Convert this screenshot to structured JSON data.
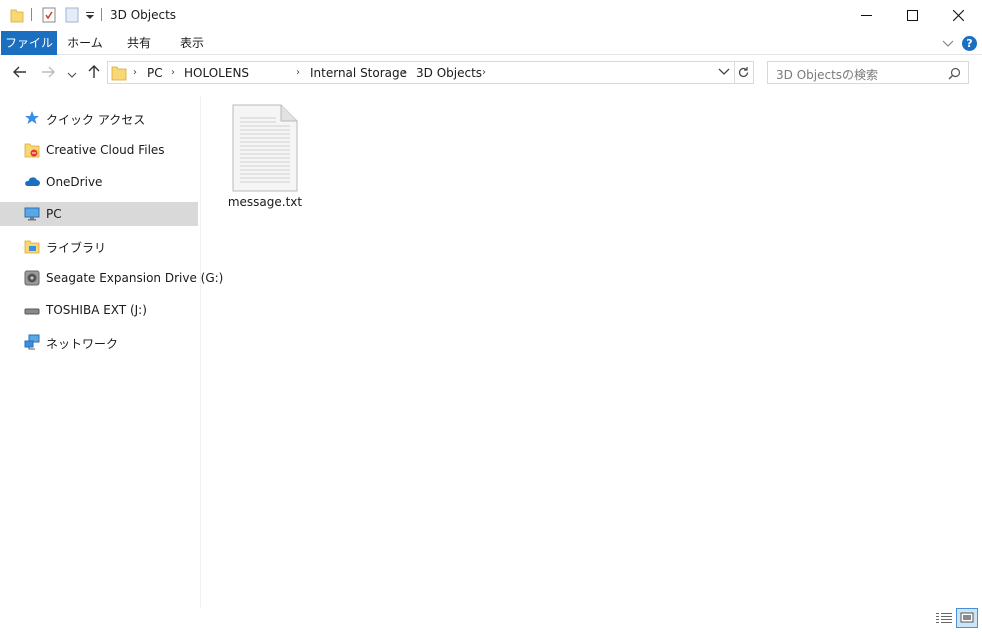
{
  "window": {
    "title": "3D Objects"
  },
  "ribbon": {
    "tabs": [
      "ファイル",
      "ホーム",
      "共有",
      "表示"
    ],
    "help_label": "?"
  },
  "address": {
    "crumbs": [
      "PC",
      "HOLOLENS",
      "Internal Storage",
      "3D Objects"
    ]
  },
  "search": {
    "placeholder": "3D Objectsの検索"
  },
  "sidebar": {
    "items": [
      {
        "label": "クイック アクセス",
        "icon": "star-icon"
      },
      {
        "label": "Creative Cloud Files",
        "icon": "creative-cloud-folder-icon"
      },
      {
        "label": "OneDrive",
        "icon": "cloud-icon"
      },
      {
        "label": "PC",
        "icon": "computer-icon",
        "selected": true
      },
      {
        "label": "ライブラリ",
        "icon": "library-icon"
      },
      {
        "label": "Seagate Expansion Drive (G:)",
        "icon": "drive-icon"
      },
      {
        "label": "TOSHIBA EXT (J:)",
        "icon": "external-drive-icon"
      },
      {
        "label": "ネットワーク",
        "icon": "network-icon"
      }
    ]
  },
  "files": [
    {
      "name": "message.txt",
      "icon": "text-file-icon"
    }
  ],
  "colors": {
    "accent": "#1a6fc0",
    "selected_bg": "#d9d9d9"
  }
}
